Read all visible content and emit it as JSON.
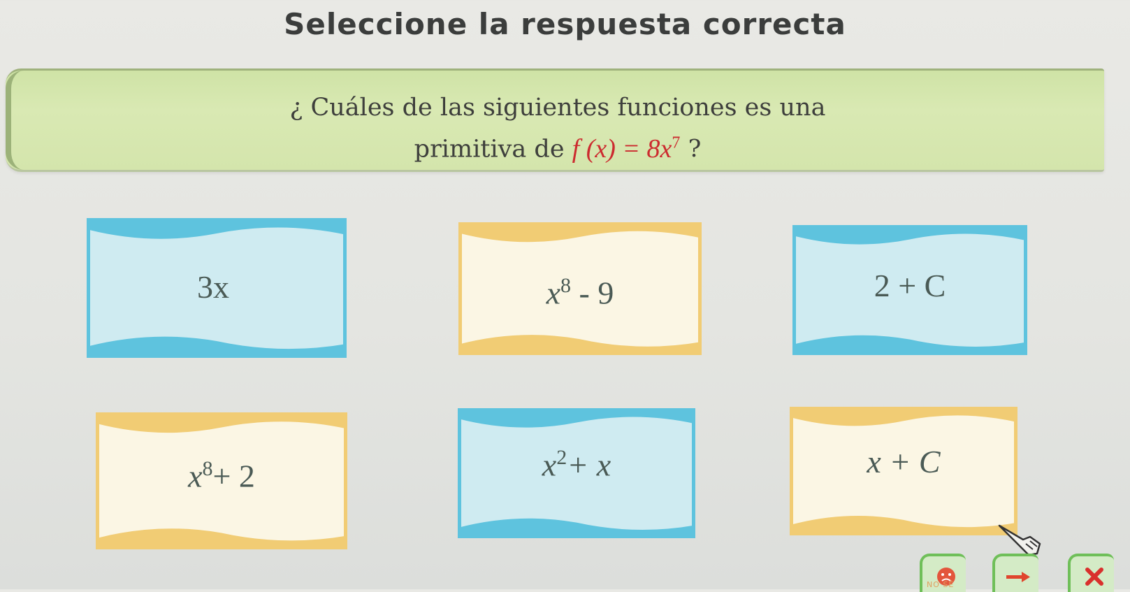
{
  "title": "Seleccione la respuesta correcta",
  "question": {
    "line1": "¿ Cuáles de las siguientes funciones es una",
    "line2_prefix": "primitiva de",
    "function": "f (x) = 8x",
    "function_exponent": "7",
    "line2_suffix": "?"
  },
  "options": [
    {
      "id": "opt1",
      "base": "3x",
      "exponent": "",
      "tail": "",
      "color": "blue"
    },
    {
      "id": "opt2",
      "base": "x",
      "exponent": "8",
      "tail": " - 9",
      "color": "yellow"
    },
    {
      "id": "opt3",
      "base": "2 + C",
      "exponent": "",
      "tail": "",
      "color": "blue"
    },
    {
      "id": "opt4",
      "base": "x",
      "exponent": "8",
      "tail": "+ 2",
      "color": "yellow"
    },
    {
      "id": "opt5",
      "base": "x",
      "exponent": "2",
      "tail": "+ x",
      "color": "blue"
    },
    {
      "id": "opt6",
      "base": "x + C",
      "exponent": "",
      "tail": "",
      "color": "yellow"
    }
  ],
  "footer": {
    "nose_label": "NO SÉ",
    "next_icon": "arrow-right-icon",
    "close_icon": "close-icon"
  },
  "colors": {
    "blue_wave": "#5ec3de",
    "blue_fill": "#cfebf1",
    "yellow_wave": "#f1cc74",
    "yellow_fill": "#fbf6e4",
    "banner": "#d6e8ad",
    "close_red": "#d9302c",
    "arrow_red": "#e0452d"
  }
}
